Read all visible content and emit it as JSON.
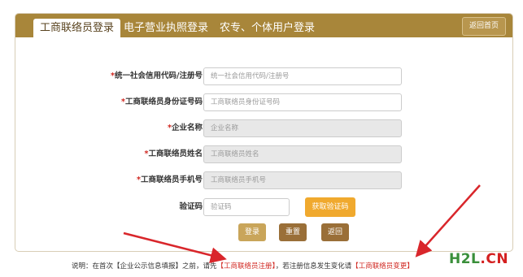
{
  "tabs": [
    {
      "label": "工商联络员登录",
      "active": true
    },
    {
      "label": "电子营业执照登录",
      "active": false
    },
    {
      "label": "农专、个体用户登录",
      "active": false
    }
  ],
  "home_button": "返回首页",
  "fields": [
    {
      "label": "统一社会信用代码/注册号",
      "placeholder": "统一社会信用代码/注册号",
      "required": "*"
    },
    {
      "label": "工商联络员身份证号码",
      "placeholder": "工商联络员身份证号码",
      "required": "*"
    },
    {
      "label": "企业名称",
      "placeholder": "企业名称",
      "required": "*"
    },
    {
      "label": "工商联络员姓名",
      "placeholder": "工商联络员姓名",
      "required": "*"
    },
    {
      "label": "工商联络员手机号",
      "placeholder": "工商联络员手机号",
      "required": "*"
    },
    {
      "label": "验证码",
      "placeholder": "验证码",
      "required": ""
    }
  ],
  "get_code_button": "获取验证码",
  "actions": {
    "login": "登录",
    "reset": "重置",
    "back": "返回"
  },
  "note": {
    "prefix": "说明：在首次【企业公示信息填报】之前，请先",
    "link1": "【工商联络员注册】",
    "middle": "，若注册信息发生变化请",
    "link2": "【工商联络员变更】"
  },
  "watermark": {
    "part1": "H2L",
    "part2": ".CN"
  },
  "colors": {
    "tabbar": "#a8863a",
    "button_tan": "#c9a55a",
    "button_brown": "#9a6f38",
    "get_code": "#f0a92e",
    "arrow_red": "#d9262b",
    "watermark_green": "#3a8f3a",
    "watermark_red": "#d42020"
  }
}
